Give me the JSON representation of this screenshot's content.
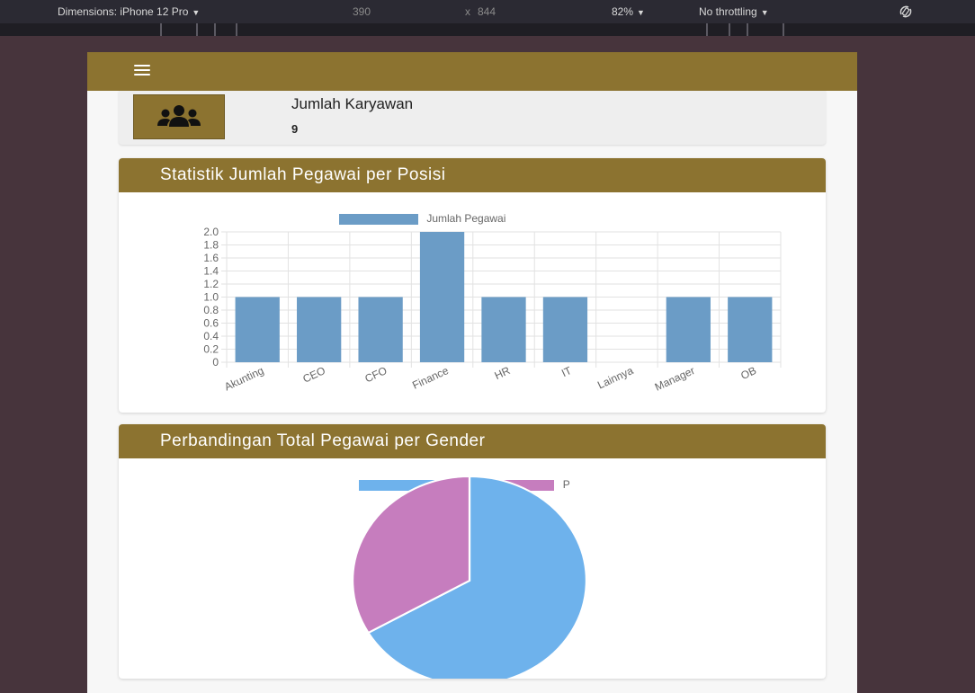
{
  "devtools": {
    "dimensions_label": "Dimensions: iPhone 12 Pro",
    "width": "390",
    "times": "x",
    "height": "844",
    "zoom": "82%",
    "throttling": "No throttling",
    "caret": "▼"
  },
  "summary": {
    "label": "Jumlah Karyawan",
    "count": "9",
    "icon": "users-icon"
  },
  "bar_card": {
    "title": "Statistik Jumlah Pegawai per Posisi"
  },
  "pie_card": {
    "title": "Perbandingan Total Pegawai per Gender"
  },
  "colors": {
    "brand": "#8c7330",
    "bar": "#6b9cc6",
    "pie_l": "#6eb2ec",
    "pie_p": "#c67dbe"
  },
  "chart_data": [
    {
      "type": "bar",
      "categories": [
        "Akunting",
        "CEO",
        "CFO",
        "Finance",
        "HR",
        "IT",
        "Lainnya",
        "Manager",
        "OB"
      ],
      "series": [
        {
          "name": "Jumlah Pegawai",
          "values": [
            1,
            1,
            1,
            2,
            1,
            1,
            0,
            1,
            1
          ]
        }
      ],
      "ylim": [
        0,
        2
      ],
      "yticks": [
        "0",
        "0.2",
        "0.4",
        "0.6",
        "0.8",
        "1.0",
        "1.2",
        "1.4",
        "1.6",
        "1.8",
        "2.0"
      ],
      "legend": "top",
      "grid": true
    },
    {
      "type": "pie",
      "labels": [
        "L",
        "P"
      ],
      "values": [
        6,
        3
      ],
      "legend": "top"
    }
  ]
}
